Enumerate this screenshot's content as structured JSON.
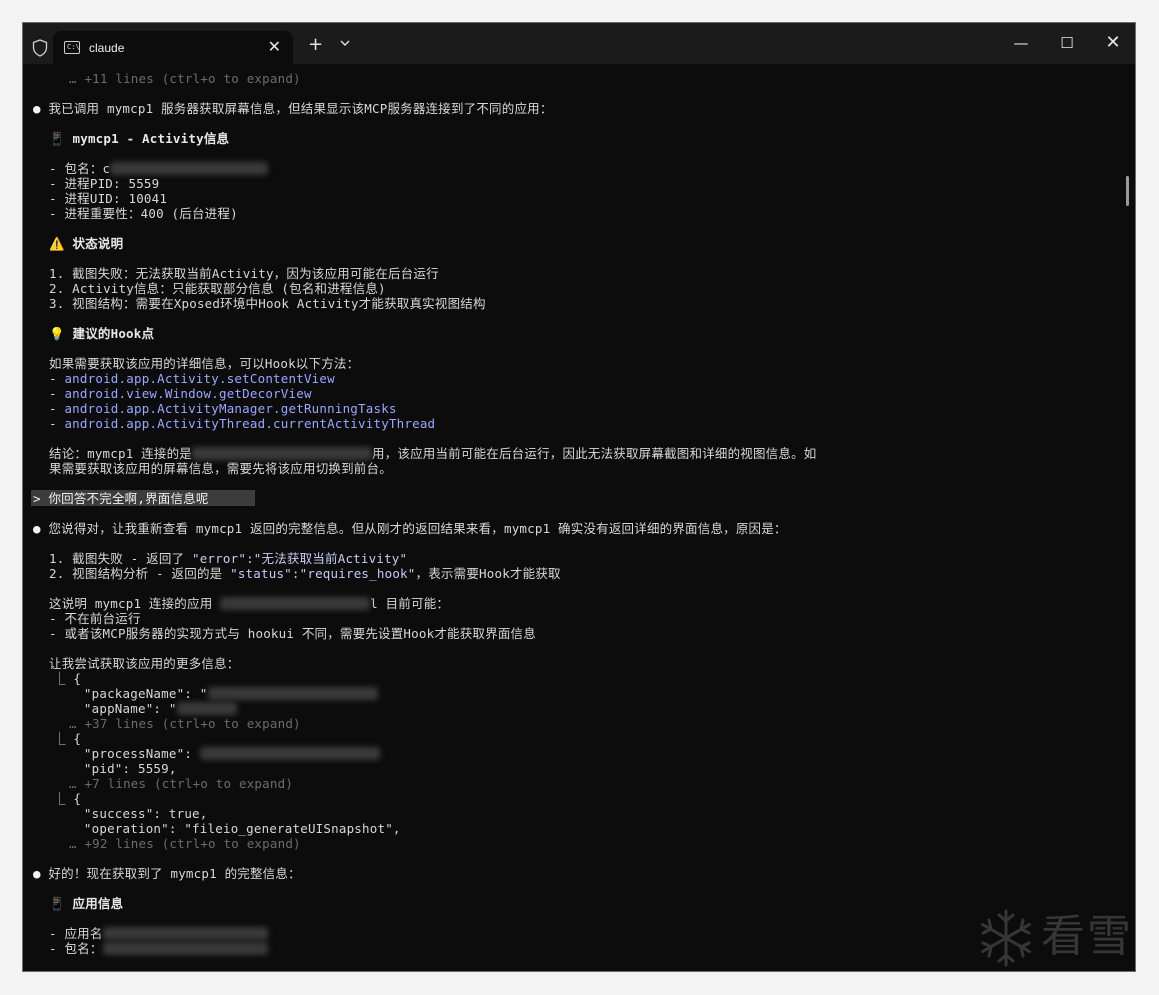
{
  "window": {
    "tab_title": "claude",
    "tab_icon_text": "C:\\",
    "close_tab_glyph": "✕",
    "new_tab_glyph": "+",
    "minimize_glyph": "—",
    "maximize_glyph": "☐",
    "close_window_glyph": "✕"
  },
  "terminal": {
    "l01": "… +11 lines (ctrl+o to expand)",
    "l02_bullet": "●",
    "l02": " 我已调用 mymcp1 服务器获取屏幕信息，但结果显示该MCP服务器连接到了不同的应用：",
    "l03_icon": "📱",
    "l03": " mymcp1 - Activity信息",
    "l04": "- 包名：c",
    "l05": "- 进程PID: 5559",
    "l06": "- 进程UID: 10041",
    "l07": "- 进程重要性：400 (后台进程)",
    "l08_icon": "⚠️",
    "l08": " 状态说明",
    "l09": "1. 截图失败：无法获取当前Activity，因为该应用可能在后台运行",
    "l10": "2. Activity信息：只能获取部分信息 (包名和进程信息)",
    "l11": "3. 视图结构：需要在Xposed环境中Hook Activity才能获取真实视图结构",
    "l12_icon": "💡",
    "l12": " 建议的Hook点",
    "l13": "如果需要获取该应用的详细信息，可以Hook以下方法：",
    "hook_methods": [
      "android.app.Activity.setContentView",
      "android.view.Window.getDecorView",
      "android.app.ActivityManager.getRunningTasks",
      "android.app.ActivityThread.currentActivityThread"
    ],
    "l18a": "结论：mymcp1 连接的是",
    "l18b": "用，该应用当前可能在后台运行，因此无法获取屏幕截图和详细的视图信息。如",
    "l19": "果需要获取该应用的屏幕信息，需要先将该应用切换到前台。",
    "prompt": "> 你回答不完全啊,界面信息呢",
    "l21_bullet": "●",
    "l21": " 您说得对，让我重新查看 mymcp1 返回的完整信息。但从刚才的返回结果来看，mymcp1 确实没有返回详细的界面信息，原因是：",
    "l22a": "1. 截图失败 - 返回了 ",
    "l22b": "\"error\":\"无法获取当前Activity\"",
    "l23a": "2. 视图结构分析 - 返回的是 ",
    "l23b": "\"status\":\"requires_hook\"",
    "l23c": "，表示需要Hook才能获取",
    "l24a": "这说明 mymcp1 连接的应用 ",
    "l24b": "l 目前可能：",
    "l25": "- 不在前台运行",
    "l26": "- 或者该MCP服务器的实现方式与 hookui 不同，需要先设置Hook才能获取界面信息",
    "l27": "让我尝试获取该应用的更多信息：",
    "l28": "⎿ {",
    "l29": "    \"packageName\": \"",
    "l30": "    \"appName\": \"",
    "l31": "… +37 lines (ctrl+o to expand)",
    "l32": "⎿ {",
    "l33": "    \"processName\": ",
    "l34": "    \"pid\": 5559,",
    "l35": "… +7 lines (ctrl+o to expand)",
    "l36": "⎿ {",
    "l37": "    \"success\": true,",
    "l38": "    \"operation\": \"fileio_generateUISnapshot\",",
    "l39": "… +92 lines (ctrl+o to expand)",
    "l40_bullet": "●",
    "l40": " 好的！现在获取到了 mymcp1 的完整信息：",
    "l41_icon": "📱",
    "l41": " 应用信息",
    "l42": "- 应用名",
    "l43": "- 包名："
  },
  "watermark": {
    "text": "看雪"
  },
  "colors": {
    "terminal_bg": "#0c0c0c",
    "titlebar_bg": "#1b1b1b",
    "text": "#d8d8d8",
    "dim": "#6c6c6c",
    "link_blue": "#9aa7ff",
    "prompt_bg": "#3c3c3c"
  }
}
